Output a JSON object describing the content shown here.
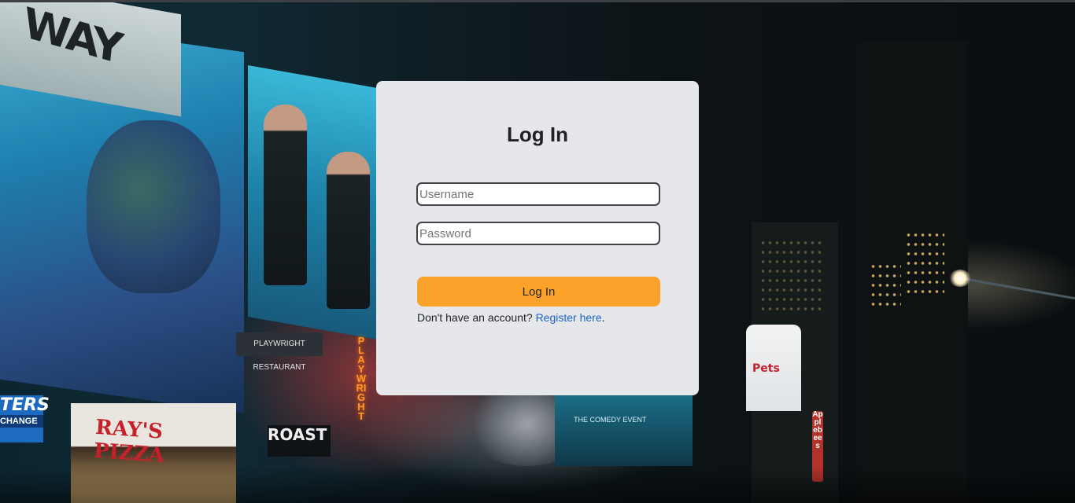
{
  "background": {
    "billboard_top_text": "WAY",
    "storefront_text": "RAY'S PIZZA",
    "sign_left_text": "TERS",
    "sign_left_subtext": "CHANGE",
    "restaurant_text": "PLAYWRIGHT RESTAURANT",
    "roast_text": "ROAST",
    "playwright_vertical_text": "PLAYWRIGHT",
    "bunny_board_text": "Pets",
    "applebees_text": "Applebees",
    "screen_text": "THE COMEDY EVENT"
  },
  "login": {
    "title": "Log In",
    "username_placeholder": "Username",
    "password_placeholder": "Password",
    "submit_label": "Log In",
    "footer_text": "Don't have an account?",
    "register_link": "Register here",
    "footer_period": "."
  },
  "colors": {
    "card_bg": "#e5e7eb",
    "button_bg": "#fba22b",
    "link": "#1a63c8",
    "text": "#1f2125"
  }
}
